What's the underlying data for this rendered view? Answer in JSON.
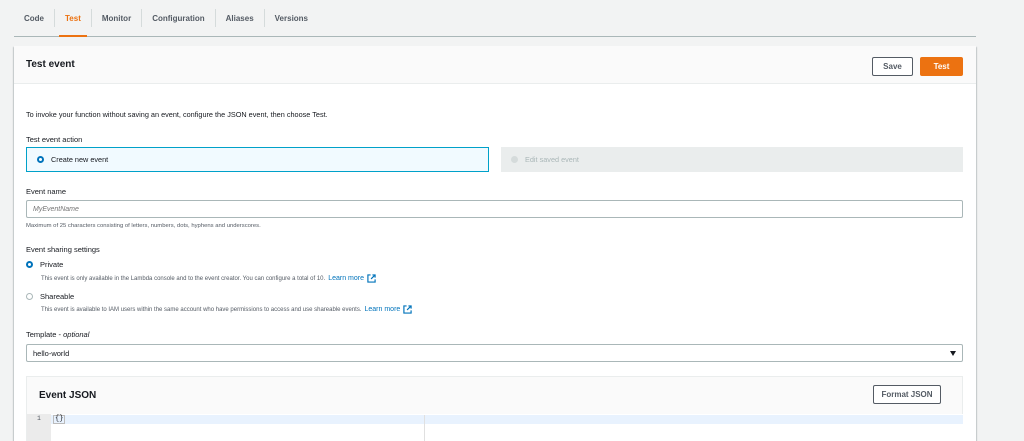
{
  "tabs": [
    {
      "label": "Code",
      "active": false
    },
    {
      "label": "Test",
      "active": true
    },
    {
      "label": "Monitor",
      "active": false
    },
    {
      "label": "Configuration",
      "active": false
    },
    {
      "label": "Aliases",
      "active": false
    },
    {
      "label": "Versions",
      "active": false
    }
  ],
  "panel": {
    "title": "Test event",
    "save_label": "Save",
    "test_label": "Test",
    "intro": "To invoke your function without saving an event, configure the JSON event, then choose Test.",
    "action_label": "Test event action",
    "create_new_label": "Create new event",
    "edit_saved_label": "Edit saved event",
    "event_name_label": "Event name",
    "event_name_placeholder": "MyEventName",
    "event_name_hint": "Maximum of 25 characters consisting of letters, numbers, dots, hyphens and underscores.",
    "sharing_label": "Event sharing settings",
    "private_label": "Private",
    "private_desc": "This event is only available in the Lambda console and to the event creator. You can configure a total of 10.",
    "shareable_label": "Shareable",
    "shareable_desc": "This event is available to IAM users within the same account who have permissions to access and use shareable events.",
    "learn_more": "Learn more",
    "template_label": "Template",
    "template_optional": "optional",
    "template_value": "hello-world",
    "json_title": "Event JSON",
    "format_json_label": "Format JSON",
    "line_number": "1",
    "code": "{}"
  },
  "colors": {
    "accent": "#ec7211",
    "link": "#0073bb",
    "selected_border": "#00a1c9"
  },
  "icons": [
    "radio-selected-icon",
    "radio-unselected-icon",
    "external-link-icon",
    "caret-down-icon"
  ]
}
